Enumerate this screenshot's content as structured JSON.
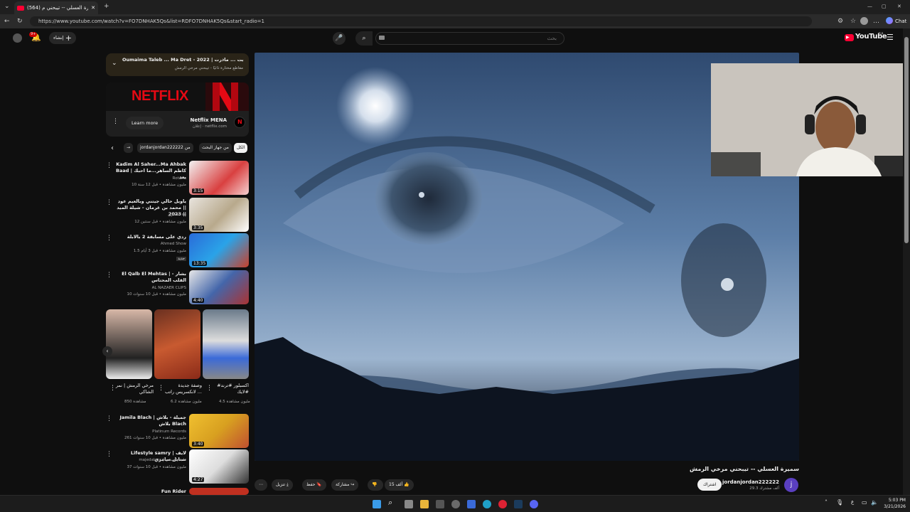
{
  "browser": {
    "tab_title": "(564) سميرة العسلي -- تيبحني م...",
    "url": "https://www.youtube.com/watch?v=FO7DNHAK5Qs&list=RDFO7DNHAK5Qs&start_radio=1",
    "chat_label": "Chat"
  },
  "header": {
    "logo_text": "YouTube",
    "region": "SA",
    "search_placeholder": "بحث",
    "create_label": "إنشاء",
    "notif_count": "9+"
  },
  "playlist_bar": {
    "title": "Oumaima Taleb ... Ma Dret - 2022 | فالتي... مالقيت ... ماذرت",
    "subtitle": "مقاطع مختارة ذاتيًا - تيبحني مرخي الرمش"
  },
  "ad": {
    "logo_text": "NETFLIX",
    "name": "Netflix MENA",
    "label": "إعلان",
    "domain": "netflix.com",
    "cta": "Learn more"
  },
  "chips": [
    "الكل",
    "من جهاز البحث",
    "jordanjordan222222 من",
    "→"
  ],
  "videos": [
    {
      "title": "Kadim Al Saher...Ma Ahbak Baad | كاظم الساهر...ما احبك بعد",
      "channel": "Rotana",
      "meta": "10 مليون مشاهدة • قبل 12 سنة",
      "duration": "3:15"
    },
    {
      "title": "ياويل حالي جيتني وبالعيم عود || محمد بن غرمان - شيلة الميد || 2023",
      "channel": "العكبري sa",
      "meta": "12 مليون مشاهدة • قبل سنتين",
      "duration": "3:35"
    },
    {
      "title": "ردي على مسابقة 2 بالابلة",
      "channel": "Ahmed Show",
      "meta": "1.5 مليون مشاهدة • قبل 3 أيام",
      "duration": "13:35",
      "badge": "جديد"
    },
    {
      "title": "El Qalb El Mehtas | بشار - القلب المحتاس",
      "channel": "AL NAZAER CLIPS",
      "meta": "10 مليون مشاهدة • قبل 10 سنوات",
      "duration": "4:40"
    },
    {
      "title": "Jamila Blach | جميلة - بلاش بلاش Blach",
      "channel": "Platinum Records",
      "meta": "261 مليون مشاهدة • قبل 10 سنوات",
      "duration": "3:40"
    },
    {
      "title": "Lifestyle samry | لايف ستايل سامري",
      "channel": "majedalesa | ماجد العيسى",
      "meta": "37 مليون مشاهدة • قبل 10 سنوات",
      "duration": "4:27"
    },
    {
      "title": "Fun Rider",
      "channel": "",
      "meta": "",
      "duration": ""
    }
  ],
  "shorts": [
    {
      "title": "#اكسبلور #ترند #لايك",
      "views": "4.5 مليون مشاهدة"
    },
    {
      "title": "وصفة جديدة لانكسريس راتب ...",
      "views": "6.2 مليون مشاهدة"
    },
    {
      "title": "مرخي الرمش | نمر الشاكي",
      "views": "850 مشاهدة"
    }
  ],
  "video": {
    "title": "سميرة العسلي -- تيبحني مرخي الرمش",
    "channel": "jordanjordan222222",
    "subscribers": "29.3 ألف مشترك",
    "avatar_letter": "j",
    "subscribe_label": "اشتراك",
    "likes": "15 ألف",
    "share_label": "مشاركة",
    "save_label": "حفظ",
    "download_label": "تنزيل"
  },
  "taskbar": {
    "lang": "ع",
    "time": "5:03 PM",
    "date": "3/21/2026"
  },
  "colors": {
    "brand": "#ff0033",
    "bg": "#0f0f0f",
    "netflix": "#e50914"
  }
}
